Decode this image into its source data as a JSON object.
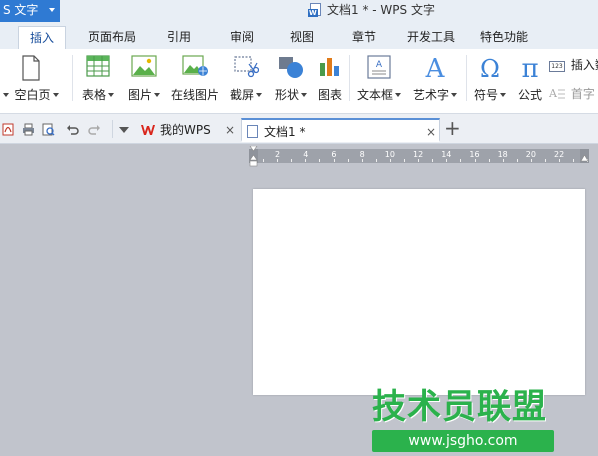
{
  "app": {
    "menu_label": "S 文字",
    "window_title": "文档1 * - WPS 文字"
  },
  "menu": {
    "tabs": [
      "插入",
      "页面布局",
      "引用",
      "审阅",
      "视图",
      "章节",
      "开发工具",
      "特色功能"
    ],
    "active": "插入"
  },
  "ribbon": {
    "blank_page": "空白页",
    "table": "表格",
    "picture": "图片",
    "online_picture": "在线图片",
    "screenshot": "截屏",
    "shape": "形状",
    "chart": "图表",
    "textbox": "文本框",
    "wordart": "艺术字",
    "symbol": "符号",
    "formula": "公式",
    "insert_number": "插入数",
    "drop_cap": "首字",
    "number_badge": "123"
  },
  "doc_tabs": {
    "tab1": "我的WPS",
    "tab2": "文档1 *",
    "close": "×",
    "add": "+"
  },
  "ruler": {
    "labels": [
      "2",
      "4",
      "6",
      "8",
      "10",
      "12",
      "14",
      "16",
      "18",
      "20",
      "22"
    ]
  },
  "watermark": {
    "text": "技术员联盟",
    "url": "www.jsgho.com"
  },
  "colors": {
    "accent": "#2f7ad3",
    "canvas": "#c1c4cc",
    "watermark_green": "#2bb24c"
  }
}
